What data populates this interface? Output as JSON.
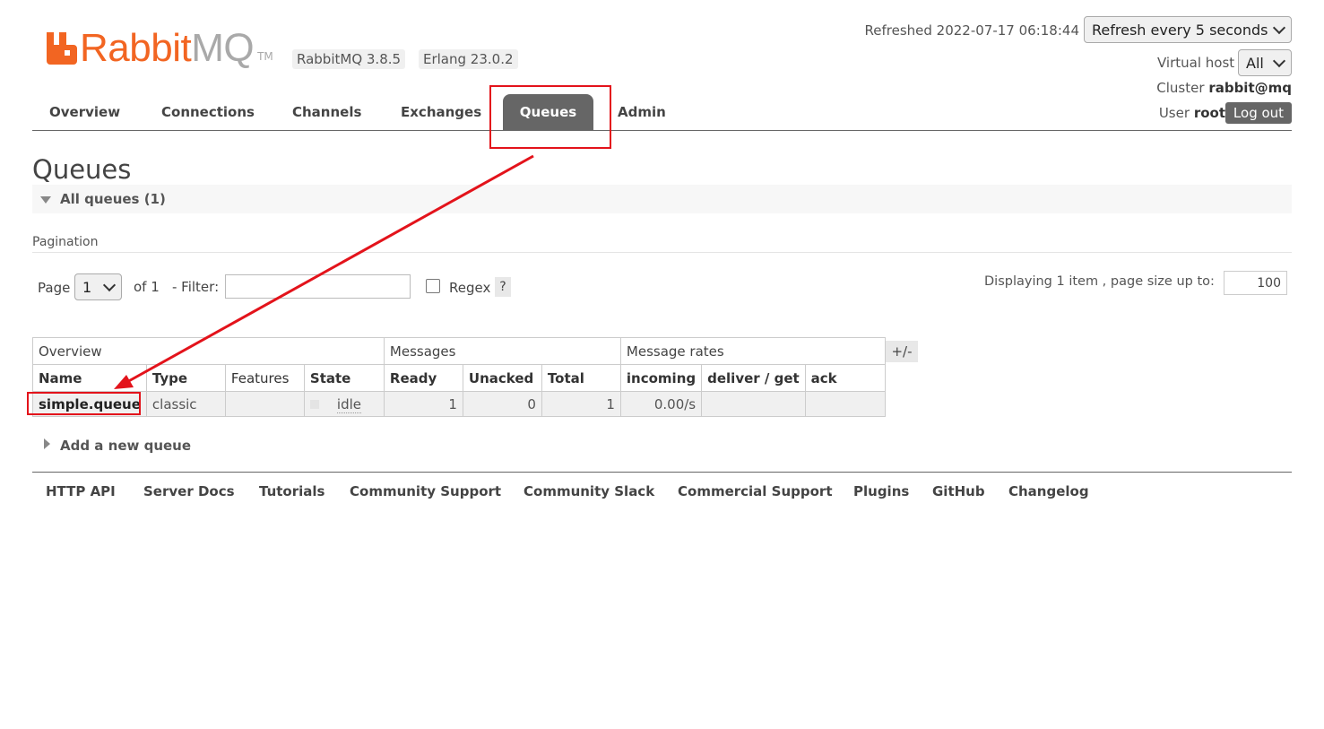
{
  "header": {
    "logo_text_primary": "Rabbit",
    "logo_text_secondary": "MQ",
    "logo_trademark": "TM",
    "rabbitmq_version": "RabbitMQ 3.8.5",
    "erlang_version": "Erlang 23.0.2",
    "refreshed_text": "Refreshed 2022-07-17 06:18:44",
    "refresh_select_value": "Refresh every 5 seconds",
    "virtual_host_label": "Virtual host",
    "virtual_host_value": "All",
    "cluster_label": "Cluster",
    "cluster_value": "rabbit@mq",
    "user_label": "User",
    "user_value": "root",
    "logout_label": "Log out"
  },
  "nav": {
    "tabs": [
      {
        "label": "Overview",
        "active": false
      },
      {
        "label": "Connections",
        "active": false
      },
      {
        "label": "Channels",
        "active": false
      },
      {
        "label": "Exchanges",
        "active": false
      },
      {
        "label": "Queues",
        "active": true
      },
      {
        "label": "Admin",
        "active": false
      }
    ]
  },
  "page": {
    "title": "Queues",
    "section_label": "All queues (1)",
    "pagination_label": "Pagination",
    "page_label": "Page",
    "page_value": "1",
    "of_label": "of 1",
    "filter_label": "- Filter:",
    "filter_value": "",
    "regex_label": "Regex",
    "regex_checked": false,
    "help_label": "?",
    "displaying_text": "Displaying 1 item , page size up to:",
    "page_size_value": "100",
    "columns_toggle": "+/-",
    "add_queue_label": "Add a new queue"
  },
  "table": {
    "groups": [
      "Overview",
      "Messages",
      "Message rates"
    ],
    "headers": [
      "Name",
      "Type",
      "Features",
      "State",
      "Ready",
      "Unacked",
      "Total",
      "incoming",
      "deliver / get",
      "ack"
    ],
    "rows": [
      {
        "name": "simple.queue",
        "type": "classic",
        "features": "",
        "state": "idle",
        "ready": "1",
        "unacked": "0",
        "total": "1",
        "incoming": "0.00/s",
        "deliver_get": "",
        "ack": ""
      }
    ]
  },
  "footer": {
    "links": [
      "HTTP API",
      "Server Docs",
      "Tutorials",
      "Community Support",
      "Community Slack",
      "Commercial Support",
      "Plugins",
      "GitHub",
      "Changelog"
    ]
  },
  "colors": {
    "brand_orange": "#f26522",
    "logo_grey": "#a9a9a9",
    "active_tab": "#666666",
    "annotation_red": "#e3131b"
  }
}
